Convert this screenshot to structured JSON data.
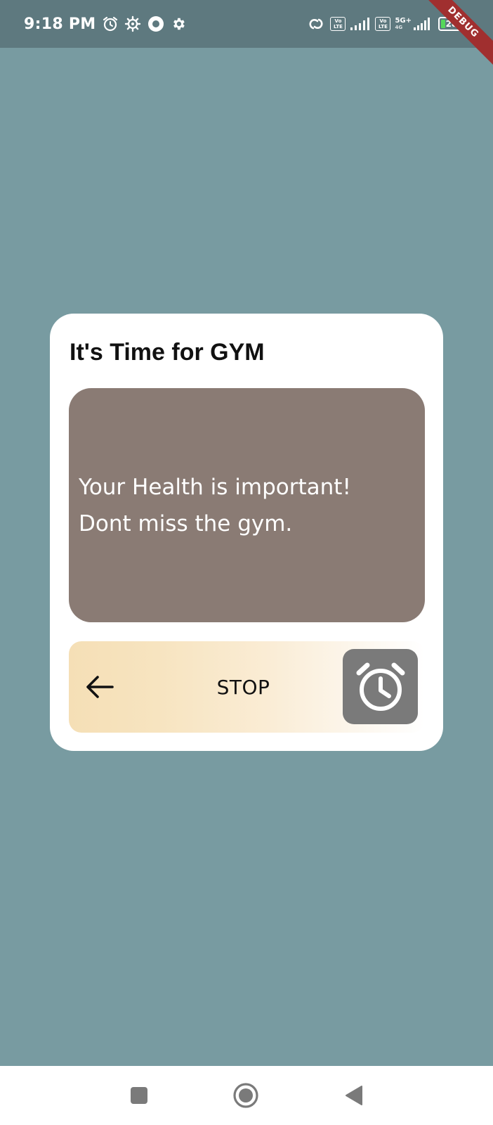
{
  "status_bar": {
    "time": "9:18 PM",
    "left_icons": [
      "alarm-icon",
      "gear-icon",
      "record-icon",
      "settings-small-icon"
    ],
    "right_icons": [
      "hotspot-icon",
      "volte-icon",
      "signal-icon",
      "volte-icon",
      "signal-5g-icon",
      "battery-icon"
    ],
    "volte_top": "Vo",
    "volte_bottom": "LTE",
    "network_type": "5G+",
    "network_sub": "4G",
    "battery_level": "28",
    "battery_color": "#55d85a"
  },
  "debug_banner": "DEBUG",
  "alarm_card": {
    "title": "It's Time for GYM",
    "message_line1": "Your Health is important!",
    "message_line2": "Dont miss the gym.",
    "message_bg": "#8a7b74",
    "slider": {
      "label": "STOP",
      "arrow_icon": "arrow-left-icon",
      "handle_icon": "alarm-clock-icon",
      "handle_color": "#7a7a7a"
    }
  },
  "nav_bar": {
    "buttons": [
      "recents-icon",
      "home-icon",
      "back-icon"
    ]
  },
  "colors": {
    "background": "#789ba1",
    "status_bar": "#5e797f",
    "card": "#ffffff"
  }
}
